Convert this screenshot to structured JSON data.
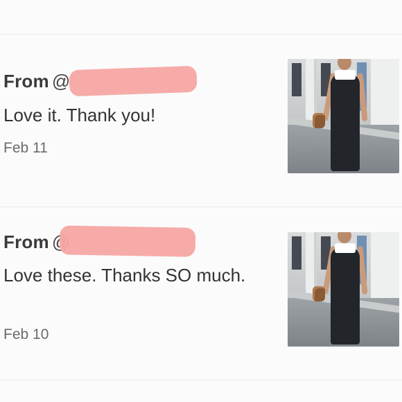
{
  "reviews": [
    {
      "from_label": "From",
      "handle": "@",
      "message": "Love it. Thank you!",
      "date": "Feb 11",
      "thumbnail_icon": "product-photo-black-maxi-overall-dress"
    },
    {
      "from_label": "From",
      "handle": "@",
      "message": "Love these. Thanks SO much.",
      "date": "Feb 10",
      "thumbnail_icon": "product-photo-black-maxi-overall-dress"
    }
  ],
  "colors": {
    "redaction": "#f7a7a3",
    "background": "#fbfbfc",
    "divider": "#e9e9ec",
    "text": "#333333",
    "date_text": "#6a6a6a"
  }
}
